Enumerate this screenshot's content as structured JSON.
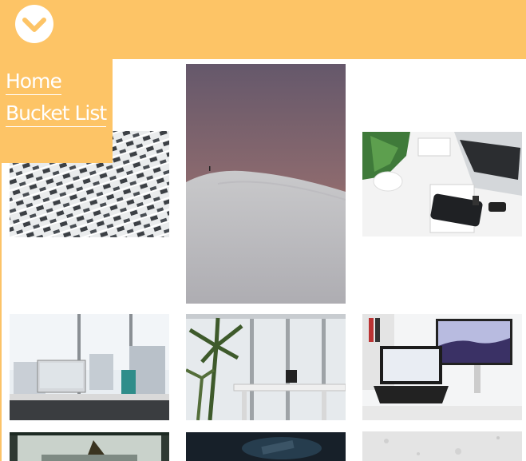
{
  "nav": {
    "toggle_icon": "chevron-down-icon",
    "links": [
      {
        "label": "Home"
      },
      {
        "label": "Bucket List"
      }
    ]
  },
  "gallery": {
    "images": [
      {
        "icon": "white-woven-facade-photo"
      },
      {
        "icon": "white-sand-dune-sunset-photo"
      },
      {
        "icon": "laptop-phone-smartwatch-desk-photo"
      },
      {
        "icon": "office-desk-imac-city-view-photo"
      },
      {
        "icon": "office-palm-plants-window-photo"
      },
      {
        "icon": "desk-laptop-monitor-photo"
      },
      {
        "icon": "lamp-window-photo"
      },
      {
        "icon": "dark-keyboard-photo"
      },
      {
        "icon": "concrete-texture-photo"
      }
    ]
  },
  "colors": {
    "accent": "#fdc466",
    "link_text": "#ffffff"
  }
}
